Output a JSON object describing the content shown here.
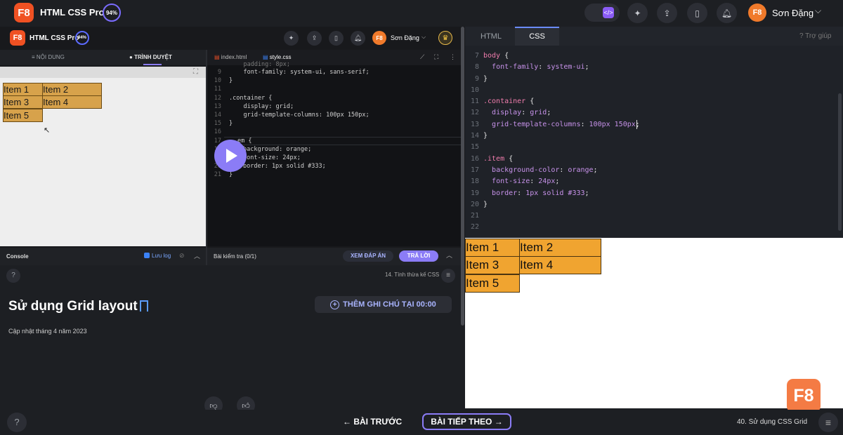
{
  "app": {
    "logo": "F8",
    "course_title": "HTML CSS Pro",
    "progress": "94%",
    "user": "Sơn Đặng"
  },
  "inner": {
    "logo": "F8",
    "title": "HTML CSS Pro",
    "progress": "94%",
    "user": "Sơn Đặng"
  },
  "left_tabs": {
    "content": "NỘI DUNG",
    "browser": "TRÌNH DUYỆT"
  },
  "preview_items": [
    "Item 1",
    "Item 2",
    "Item 3",
    "Item 4",
    "Item 5"
  ],
  "editor": {
    "tab1": "index.html",
    "tab2": "style.css",
    "line_numbers": [
      "9",
      "10",
      "11",
      "12",
      "13",
      "14",
      "15",
      "16",
      "17",
      "18",
      "19",
      "20",
      "21"
    ],
    "lines": [
      "    font-family: system-ui, sans-serif;",
      "}",
      "",
      ".container {",
      "    display: grid;",
      "    grid-template-columns: 100px 150px;",
      "}",
      "",
      "em {",
      "background: orange;",
      "font-size: 24px;",
      "border: 1px solid #333;",
      "}"
    ],
    "cut_line": "    padding: 8px;"
  },
  "console": {
    "label": "Console",
    "save_log": "Lưu log"
  },
  "quiz": {
    "label": "Bài kiểm tra (0/1)",
    "view_answer": "XEM ĐÁP ÁN",
    "answer": "TRẢ LỜI"
  },
  "lesson_ref": "14. Tính thừa kế CSS",
  "lesson": {
    "title": "Sử dụng Grid layout",
    "updated": "Cập nhật tháng 4 năm 2023",
    "add_note": "THÊM GHI CHÚ TẠI 00:00"
  },
  "right": {
    "tab_html": "HTML",
    "tab_css": "CSS",
    "help": "Trợ giúp",
    "line_numbers": [
      "7",
      "8",
      "9",
      "10",
      "11",
      "12",
      "13",
      "14",
      "15",
      "16",
      "17",
      "18",
      "19",
      "20",
      "21",
      "22"
    ],
    "lines": [
      [
        [
          "k",
          "body"
        ],
        [
          "b",
          " {"
        ]
      ],
      [
        [
          "b",
          "  "
        ],
        [
          "s",
          "font-family"
        ],
        [
          "b",
          ": "
        ],
        [
          "s",
          "system-ui"
        ],
        [
          "b",
          ";"
        ]
      ],
      [
        [
          "b",
          "}"
        ]
      ],
      [],
      [
        [
          "k",
          ".container"
        ],
        [
          "b",
          " {"
        ]
      ],
      [
        [
          "b",
          "  "
        ],
        [
          "s",
          "display"
        ],
        [
          "b",
          ": "
        ],
        [
          "s",
          "grid"
        ],
        [
          "b",
          ";"
        ]
      ],
      [
        [
          "b",
          "  "
        ],
        [
          "s",
          "grid-template-columns"
        ],
        [
          "b",
          ": "
        ],
        [
          "s",
          "100px 150px"
        ],
        [
          "b",
          ";"
        ]
      ],
      [
        [
          "b",
          "}"
        ]
      ],
      [],
      [
        [
          "k",
          ".item"
        ],
        [
          "b",
          " {"
        ]
      ],
      [
        [
          "b",
          "  "
        ],
        [
          "s",
          "background-color"
        ],
        [
          "b",
          ": "
        ],
        [
          "s",
          "orange"
        ],
        [
          "b",
          ";"
        ]
      ],
      [
        [
          "b",
          "  "
        ],
        [
          "s",
          "font-size"
        ],
        [
          "b",
          ": "
        ],
        [
          "s",
          "24px"
        ],
        [
          "b",
          ";"
        ]
      ],
      [
        [
          "b",
          "  "
        ],
        [
          "s",
          "border"
        ],
        [
          "b",
          ": "
        ],
        [
          "s",
          "1px solid #333"
        ],
        [
          "b",
          ";"
        ]
      ],
      [
        [
          "b",
          "}"
        ]
      ],
      [],
      []
    ]
  },
  "result_items": [
    "Item 1",
    "Item 2",
    "Item 3",
    "Item 4",
    "Item 5"
  ],
  "footer": {
    "prev": "← BÀI TRƯỚC",
    "next": "BÀI TIẾP THEO →",
    "lesson": "40. Sử dụng CSS Grid"
  },
  "watermark": "F8",
  "colors": {
    "accent": "#f05123",
    "purple": "#8b7cf6",
    "item_bg": "#f0a430"
  }
}
